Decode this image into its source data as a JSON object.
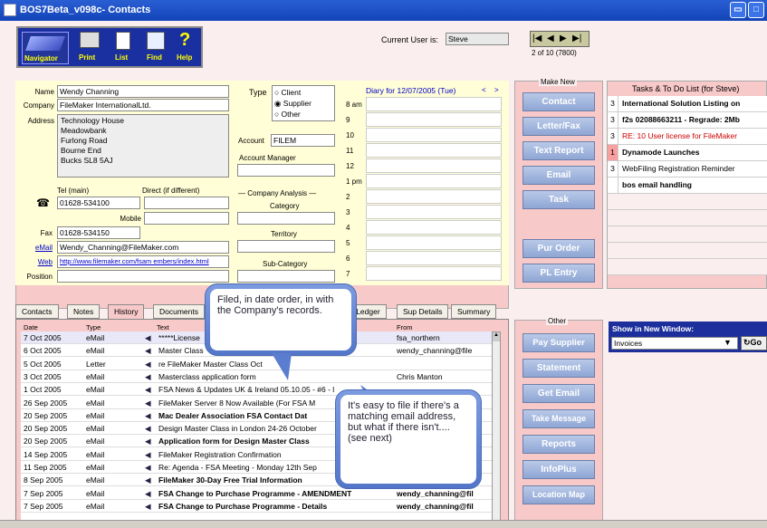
{
  "window": {
    "title": "BOS7Beta_v098c- Contacts"
  },
  "toolbar": {
    "items": [
      "Navigator",
      "Print",
      "List",
      "Find",
      "Help"
    ]
  },
  "header": {
    "current_user_label": "Current User is:",
    "current_user": "Steve",
    "record_count": "2 of 10 (7800)"
  },
  "contact": {
    "name_label": "Name",
    "name": "Wendy Channing",
    "company_label": "Company",
    "company": "FileMaker InternationalLtd.",
    "address_label": "Address",
    "address_lines": [
      "Technology House",
      "Meadowbank",
      "Furlong Road",
      "Bourne End",
      "Bucks SL8 5AJ"
    ],
    "tel_main_label": "Tel (main)",
    "direct_label": "Direct (if different)",
    "tel_main": "01628-534100",
    "mobile_label": "Mobile",
    "fax_label": "Fax",
    "fax": "01628-534150",
    "email_label": "eMail",
    "email": "Wendy_Channing@FileMaker.com",
    "web_label": "Web",
    "web": "http://www.filemaker.com/fsam embers/index.html",
    "position_label": "Position"
  },
  "type": {
    "label": "Type",
    "options": [
      "Client",
      "Supplier",
      "Other"
    ],
    "selected": "Supplier",
    "account_label": "Account",
    "account": "FILEM",
    "account_manager_label": "Account Manager",
    "company_analysis_label": "Company Analysis",
    "category_label": "Category",
    "territory_label": "Territory",
    "subcategory_label": "Sub-Category"
  },
  "diary": {
    "title": "Diary for 12/07/2005 (Tue)",
    "prev": "<",
    "next": ">",
    "hours": [
      "8 am",
      "9",
      "10",
      "11",
      "12",
      "1 pm",
      "2",
      "3",
      "4",
      "5",
      "6",
      "7"
    ]
  },
  "make_new": {
    "title": "Make New",
    "buttons": [
      "Contact",
      "Letter/Fax",
      "Text Report",
      "Email",
      "Task",
      "Pur Order",
      "PL Entry"
    ]
  },
  "tasks": {
    "title": "Tasks & To Do List (for Steve)",
    "items": [
      {
        "n": "3",
        "text": "International Solution Listing on",
        "style": "bold"
      },
      {
        "n": "3",
        "text": "f2s 02088663211 - Regrade: 2Mb",
        "style": "bold"
      },
      {
        "n": "3",
        "text": "RE: 10 User license for FileMaker",
        "style": "red"
      },
      {
        "n": "1",
        "text": "Dynamode Launches",
        "style": "bold"
      },
      {
        "n": "3",
        "text": "WebFiling Registration Reminder",
        "style": "normal"
      },
      {
        "n": "",
        "text": "bos email handling",
        "style": "bold"
      }
    ]
  },
  "tabs": [
    "Contacts",
    "Notes",
    "History",
    "Documents",
    "r Ledger",
    "Sup Details",
    "Summary"
  ],
  "history": {
    "columns": [
      "Date",
      "Type",
      "Text",
      "From"
    ],
    "rows": [
      {
        "date": "7 Oct 2005",
        "type": "eMail",
        "text": "*****License",
        "from": "fsa_northern"
      },
      {
        "date": "6 Oct 2005",
        "type": "eMail",
        "text": "Master Class",
        "from": "wendy_channing@file"
      },
      {
        "date": "5 Oct 2005",
        "type": "Letter",
        "text": "re FileMaker Master Class Oct",
        "from": ""
      },
      {
        "date": "3 Oct 2005",
        "type": "eMail",
        "text": "Masterclass application form",
        "from": "Chris Manton"
      },
      {
        "date": "1 Oct 2005",
        "type": "eMail",
        "text": "FSA News & Updates UK & Ireland 05.10.05 - #6 - l",
        "from": ""
      },
      {
        "date": "26 Sep 2005",
        "type": "eMail",
        "text": "FileMaker Server 8 Now Available (For FSA M",
        "from": ""
      },
      {
        "date": "20 Sep 2005",
        "type": "eMail",
        "text": "Mac Dealer Association FSA Contact Dat",
        "from": ""
      },
      {
        "date": "20 Sep 2005",
        "type": "eMail",
        "text": "Design Master Class in London 24-26 October",
        "from": ""
      },
      {
        "date": "20 Sep 2005",
        "type": "eMail",
        "text": "Application form for Design Master Class",
        "from": ""
      },
      {
        "date": "14 Sep 2005",
        "type": "eMail",
        "text": "FileMaker Registration Confirmation",
        "from": ""
      },
      {
        "date": "11 Sep 2005",
        "type": "eMail",
        "text": "Re: Agenda - FSA Meeting - Monday 12th Sep",
        "from": ""
      },
      {
        "date": "8 Sep 2005",
        "type": "eMail",
        "text": "FileMaker 30-Day Free Trial Information",
        "from": "<do_not_reply@file"
      },
      {
        "date": "7 Sep 2005",
        "type": "eMail",
        "text": "FSA Change to Purchase Programme - AMENDMENT",
        "from": "wendy_channing@fil"
      },
      {
        "date": "7 Sep 2005",
        "type": "eMail",
        "text": "FSA Change to Purchase Programme - Details",
        "from": "wendy_channing@fil"
      }
    ]
  },
  "other": {
    "title": "Other",
    "buttons": [
      "Pay Supplier",
      "Statement",
      "Get Email",
      "Take Message",
      "Reports",
      "InfoPlus",
      "Location Map"
    ]
  },
  "show_window": {
    "label": "Show in New Window:",
    "value": "Invoices",
    "go": "Go"
  },
  "callouts": {
    "one": "Filed, in date order, in with the Company's records.",
    "two": "It's easy to file if there's a matching email address, but what if there isn't.... (see next)"
  }
}
